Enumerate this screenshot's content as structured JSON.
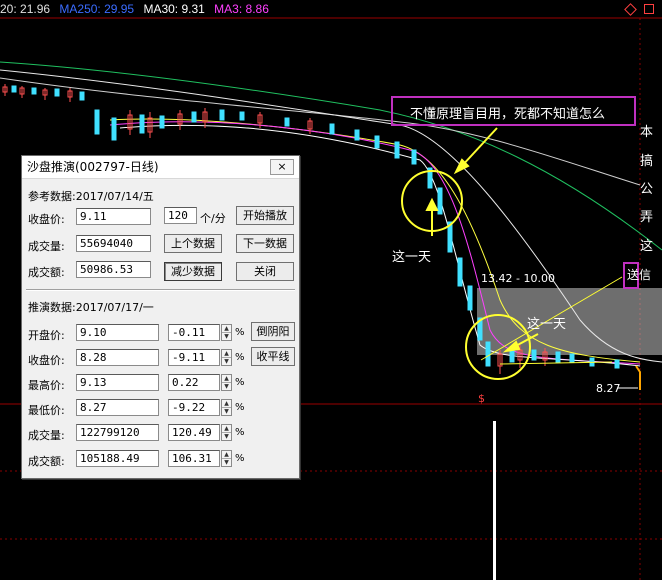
{
  "header": {
    "date": "20: 21.96",
    "ma250": "MA250: 29.95",
    "ma30": "MA30: 9.31",
    "ma3": "MA3: 8.86",
    "colors": {
      "date": "#e0e0e0",
      "ma250": "#3a6cff",
      "ma30": "#ffffff",
      "ma3": "#ff40ff"
    },
    "corner_icons": [
      "diamond-icon",
      "square-icon"
    ]
  },
  "annotations": {
    "banner": "不懂原理盲目用，死都不知道怎么",
    "side_chars": [
      "本",
      "搞",
      "公",
      "弄",
      "这"
    ],
    "side_box": "送信",
    "day_label_1": "这一天",
    "day_label_2": "这一天",
    "range_label": "13.42 - 10.00",
    "price_label": "8.27"
  },
  "dialog": {
    "title": "沙盘推演(002797-日线)",
    "close_label": "×",
    "ref_header": "参考数据:2017/07/14/五",
    "ref": {
      "close_label": "收盘价:",
      "close_value": "9.11",
      "volume_label": "成交量:",
      "volume_value": "55694040",
      "amount_label": "成交额:",
      "amount_value": "50986.53"
    },
    "speed_value": "120",
    "speed_unit": "个/分",
    "buttons": {
      "play": "开始播放",
      "prev": "上个数据",
      "next": "下一数据",
      "reduce": "减少数据",
      "close": "关闭",
      "inverted": "倒阴阳",
      "flat": "收平线"
    },
    "deduce_header": "推演数据:2017/07/17/一",
    "deduce": [
      {
        "label": "开盘价:",
        "value": "9.10",
        "change": "-0.11"
      },
      {
        "label": "收盘价:",
        "value": "8.28",
        "change": "-9.11"
      },
      {
        "label": "最高价:",
        "value": "9.13",
        "change": "0.22"
      },
      {
        "label": "最低价:",
        "value": "8.27",
        "change": "-9.22"
      },
      {
        "label": "成交量:",
        "value": "122799120",
        "change": "120.49"
      },
      {
        "label": "成交额:",
        "value": "105188.49",
        "change": "106.31"
      }
    ],
    "pct_sign": "%"
  }
}
